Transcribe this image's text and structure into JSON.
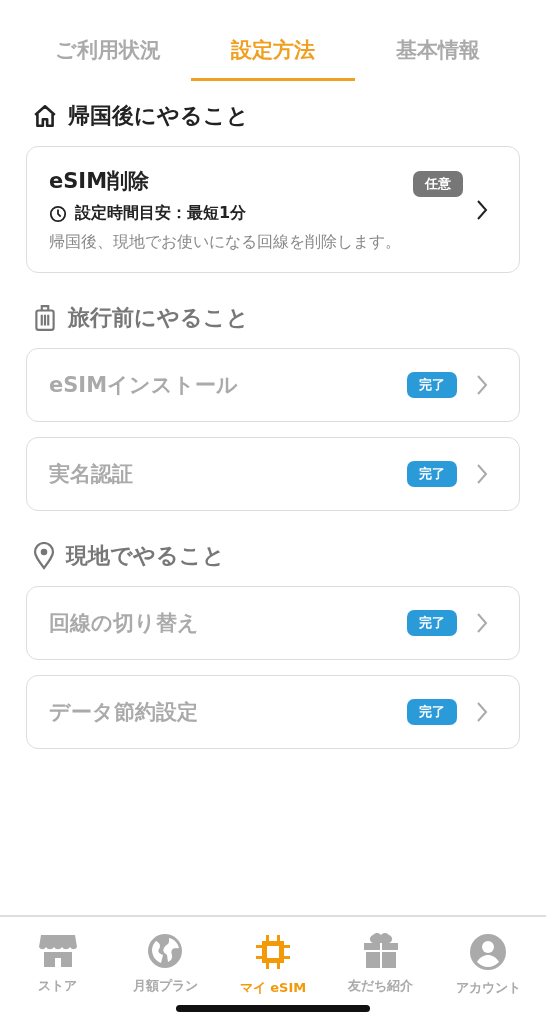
{
  "tabs": [
    {
      "label": "ご利用状況",
      "selected": false
    },
    {
      "label": "設定方法",
      "selected": true
    },
    {
      "label": "基本情報",
      "selected": false
    }
  ],
  "sections": [
    {
      "kind": "home",
      "title": "帰国後にやること",
      "current": true,
      "items": [
        {
          "title": "eSIM削除",
          "badge": "任意",
          "done": false,
          "time": "設定時間目安：最短1分",
          "description": "帰国後、現地でお使いになる回線を削除します。"
        }
      ]
    },
    {
      "kind": "luggage",
      "title": "旅行前にやること",
      "current": false,
      "items": [
        {
          "title": "eSIMインストール",
          "badge": "完了",
          "done": true
        },
        {
          "title": "実名認証",
          "badge": "完了",
          "done": true
        }
      ]
    },
    {
      "kind": "pin",
      "title": "現地でやること",
      "current": false,
      "items": [
        {
          "title": "回線の切り替え",
          "badge": "完了",
          "done": true
        },
        {
          "title": "データ節約設定",
          "badge": "完了",
          "done": true
        }
      ]
    }
  ],
  "nav": [
    {
      "kind": "store",
      "label": "ストア",
      "selected": false
    },
    {
      "kind": "globe",
      "label": "月額プラン",
      "selected": false
    },
    {
      "kind": "chip",
      "label": "マイ eSIM",
      "selected": true
    },
    {
      "kind": "gift",
      "label": "友だち紹介",
      "selected": false
    },
    {
      "kind": "account",
      "label": "アカウント",
      "selected": false
    }
  ]
}
